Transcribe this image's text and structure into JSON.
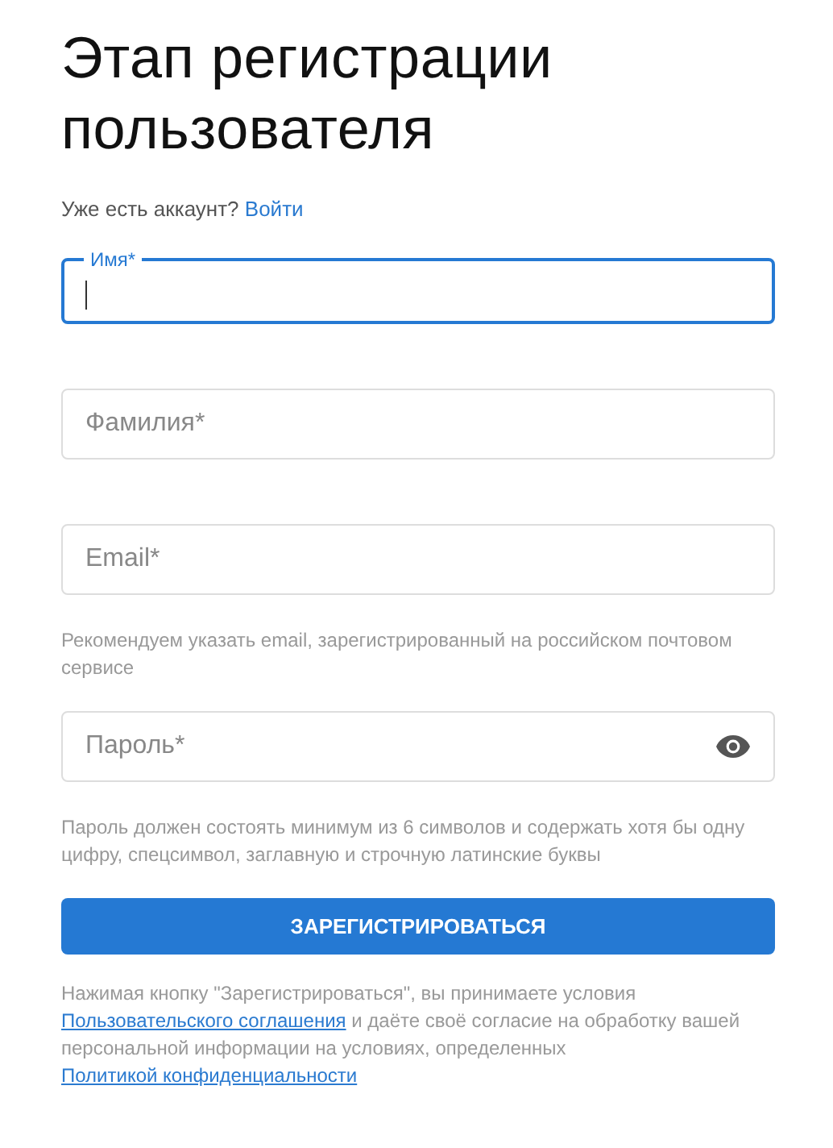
{
  "title": "Этап регистрации пользователя",
  "login_prompt": {
    "text": "Уже есть аккаунт?",
    "link": "Войти"
  },
  "fields": [
    {
      "kind": "text",
      "label": "Имя*",
      "focused": true
    },
    {
      "kind": "text",
      "label": "Фамилия*",
      "focused": false
    },
    {
      "kind": "text",
      "label": "Email*",
      "focused": false,
      "helper": "Рекомендуем указать email, зарегистрированный на российском почтовом сервисе"
    },
    {
      "kind": "password",
      "label": "Пароль*",
      "focused": false,
      "helper": "Пароль должен состоять минимум из 6 символов и содержать хотя бы одну цифру, спецсимвол, заглавную и строчную латинские буквы"
    }
  ],
  "submit_button": "ЗАРЕГИСТРИРОВАТЬСЯ",
  "terms": [
    {
      "kind": "text",
      "text": "Нажимая кнопку \"Зарегистрироваться\", вы принимаете условия"
    },
    {
      "kind": "link",
      "text": "Пользовательского соглашения"
    },
    {
      "kind": "text",
      "text": "и даёте своё согласие на обработку вашей персональной информации на условиях, определенных"
    },
    {
      "kind": "link",
      "text": "Политикой конфиденциальности"
    }
  ]
}
